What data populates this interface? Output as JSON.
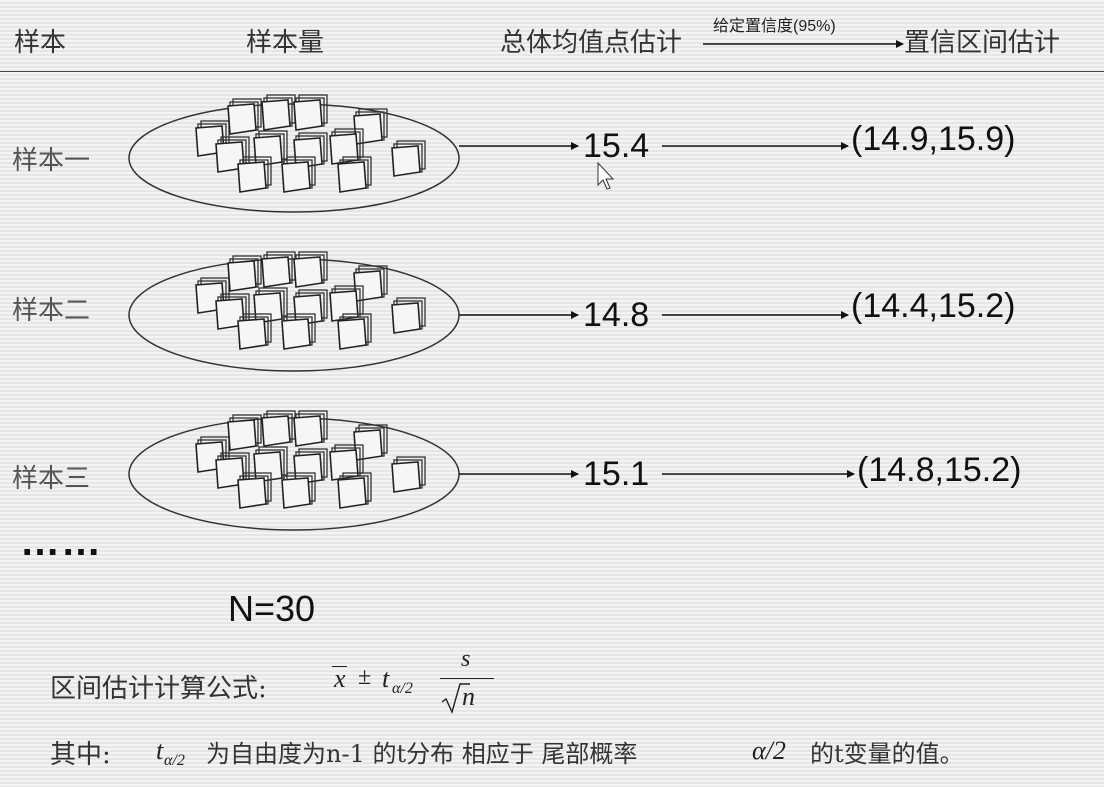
{
  "header": {
    "sample": "样本",
    "sample_size": "样本量",
    "point_estimate": "总体均值点估计",
    "confidence_label": "给定置信度(95%)",
    "interval_estimate": "置信区间估计"
  },
  "rows": [
    {
      "label": "样本一",
      "mean": "15.4",
      "interval": "(14.9,15.9)"
    },
    {
      "label": "样本二",
      "mean": "14.8",
      "interval": "(14.4,15.2)"
    },
    {
      "label": "样本三",
      "mean": "15.1",
      "interval": "(14.8,15.2)"
    }
  ],
  "ellipsis": "……",
  "n_label": "N=30",
  "formula": {
    "label": "区间估计计算公式:",
    "xbar": "x",
    "pm": "±",
    "t": "t",
    "sub": "α/2",
    "s": "s",
    "n": "n"
  },
  "note": {
    "prefix": "其中:",
    "t": "t",
    "sub": "α/2",
    "mid": "为自由度为n-1 的t分布 相应于 尾部概率",
    "alpha": "α/2",
    "suffix": "的t变量的值。"
  }
}
